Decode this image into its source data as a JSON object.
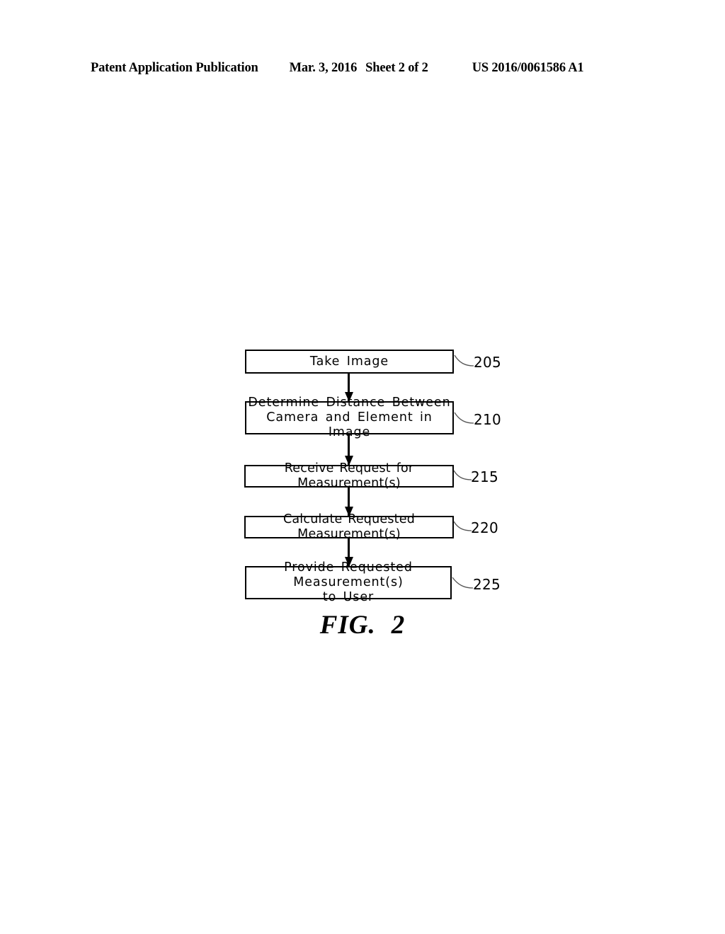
{
  "header": {
    "publication": "Patent Application Publication",
    "date": "Mar. 3, 2016",
    "sheet": "Sheet 2 of 2",
    "doc_id": "US 2016/0061586 A1"
  },
  "figure": {
    "caption_word": "FIG.",
    "caption_number": "2",
    "steps": [
      {
        "ref": "205",
        "text": "Take  Image"
      },
      {
        "ref": "210",
        "text": "Determine  Distance  Between\nCamera  and  Element  in  Image"
      },
      {
        "ref": "215",
        "text": "Receive  Request  for  Measurement(s)"
      },
      {
        "ref": "220",
        "text": "Calculate  Requested  Measurement(s)"
      },
      {
        "ref": "225",
        "text": "Provide  Requested  Measurement(s)\nto  User"
      }
    ]
  },
  "colors": {
    "ink": "#000000",
    "page": "#ffffff"
  }
}
